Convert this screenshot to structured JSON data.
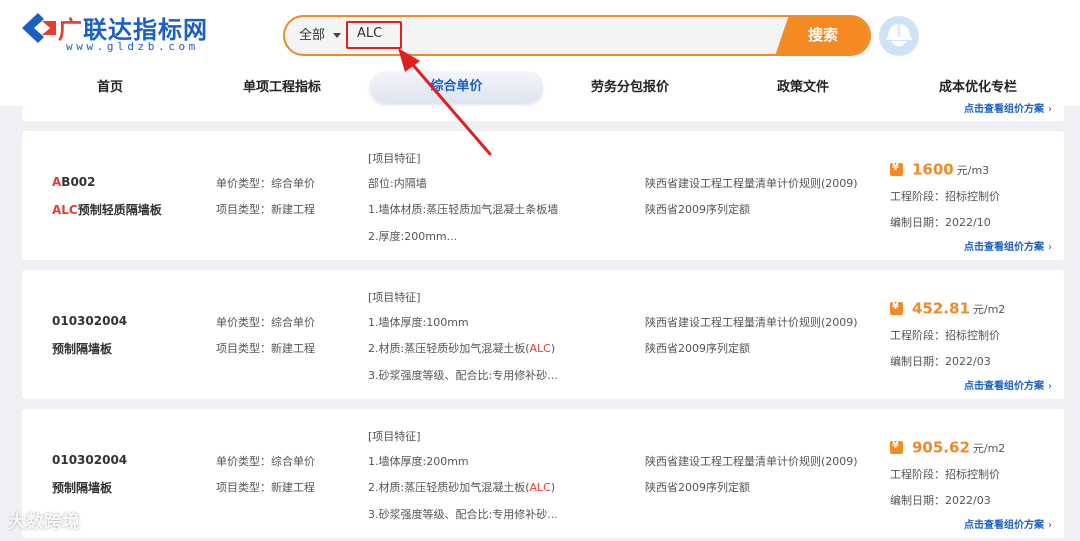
{
  "logo": {
    "title_highlight": "广",
    "title_rest": "联达指标网",
    "url": "www.gldzb.com"
  },
  "search": {
    "scope": "全部",
    "value": "ALC",
    "button": "搜索"
  },
  "nav": [
    {
      "label": "首页"
    },
    {
      "label": "单项工程指标"
    },
    {
      "label": "综合单价"
    },
    {
      "label": "劳务分包报价"
    },
    {
      "label": "政策文件"
    },
    {
      "label": "成本优化专栏"
    }
  ],
  "top_card": {
    "link": "点击查看组价方案"
  },
  "results": [
    {
      "code_hl": "A",
      "code_rest": "B002",
      "name_hl": "ALC",
      "name_rest": "预制轻质隔墙板",
      "price_type": "单价类型：综合单价",
      "project_type": "项目类型：新建工程",
      "feat_title": "[项目特征]",
      "feat_1": "部位:内隔墙",
      "feat_2_pre": "1.墙体材质:蒸压轻质加气混凝土条板墙",
      "feat_2_hl": "",
      "feat_2_post": "",
      "feat_3": "2.厚度:200mm...",
      "rule_1": "陕西省建设工程工程量清单计价规则(2009)",
      "rule_2": "陕西省2009序列定额",
      "price": "1600",
      "unit": "元/m3",
      "stage": "工程阶段：招标控制价",
      "date": "编制日期：2022/10",
      "link": "点击查看组价方案"
    },
    {
      "code_hl": "",
      "code_rest": "010302004",
      "name_hl": "",
      "name_rest": "预制隔墙板",
      "price_type": "单价类型：综合单价",
      "project_type": "项目类型：新建工程",
      "feat_title": "[项目特征]",
      "feat_1": "1.墙体厚度:100mm",
      "feat_2_pre": "2.材质:蒸压轻质砂加气混凝土板(",
      "feat_2_hl": "ALC",
      "feat_2_post": ")",
      "feat_3": "3.砂浆强度等级、配合比:专用修补砂...",
      "rule_1": "陕西省建设工程工程量清单计价规则(2009)",
      "rule_2": "陕西省2009序列定额",
      "price": "452.81",
      "unit": "元/m2",
      "stage": "工程阶段：招标控制价",
      "date": "编制日期：2022/03",
      "link": "点击查看组价方案"
    },
    {
      "code_hl": "",
      "code_rest": "010302004",
      "name_hl": "",
      "name_rest": "预制隔墙板",
      "price_type": "单价类型：综合单价",
      "project_type": "项目类型：新建工程",
      "feat_title": "[项目特征]",
      "feat_1": "1.墙体厚度:200mm",
      "feat_2_pre": "2.材质:蒸压轻质砂加气混凝土板(",
      "feat_2_hl": "ALC",
      "feat_2_post": ")",
      "feat_3": "3.砂浆强度等级、配合比:专用修补砂...",
      "rule_1": "陕西省建设工程工程量清单计价规则(2009)",
      "rule_2": "陕西省2009序列定额",
      "price": "905.62",
      "unit": "元/m2",
      "stage": "工程阶段：招标控制价",
      "date": "编制日期：2022/03",
      "link": "点击查看组价方案"
    }
  ],
  "watermark": "大数跨境",
  "colors": {
    "brand_blue": "#1a5fc4",
    "accent_orange": "#f58a22",
    "highlight_red": "#e53d2f"
  }
}
